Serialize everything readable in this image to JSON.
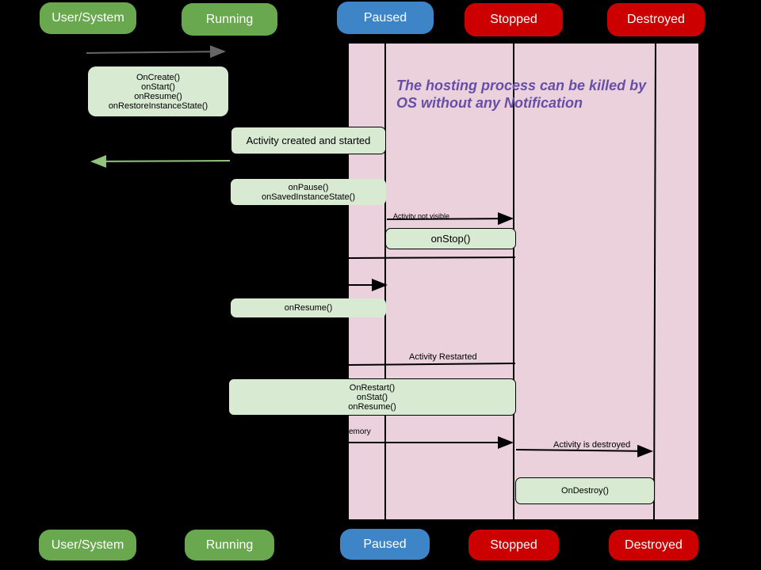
{
  "states_top": [
    "User/System",
    "Running",
    "Paused",
    "Stopped",
    "Destroyed"
  ],
  "states_bottom": [
    "User/System",
    "Running",
    "Paused",
    "Stopped",
    "Destroyed"
  ],
  "note": "The hosting process can be killed by OS without any Notification",
  "boxes": {
    "create": [
      "OnCreate()",
      "onStart()",
      "onResume()",
      "onRestoreInstanceState()"
    ],
    "created": "Activity created and started",
    "pause": [
      "onPause()",
      "onSavedInstanceState()"
    ],
    "stop": "onStop()",
    "resume": "onResume()",
    "restart": [
      "OnRestart()",
      "onStat()",
      "onResume()"
    ],
    "destroy": "OnDestroy()"
  },
  "labels": {
    "not_visible": "Activity not visible",
    "restarted": "Activity Restarted",
    "memory": "emory",
    "destroyed": "Activity is destroyed"
  },
  "colors": {
    "running": "#6aa84f",
    "paused": "#3d85c6",
    "stopped": "#cc0000",
    "lane": "#ead1dc",
    "box": "#d9ead3",
    "note": "#674ea7"
  }
}
